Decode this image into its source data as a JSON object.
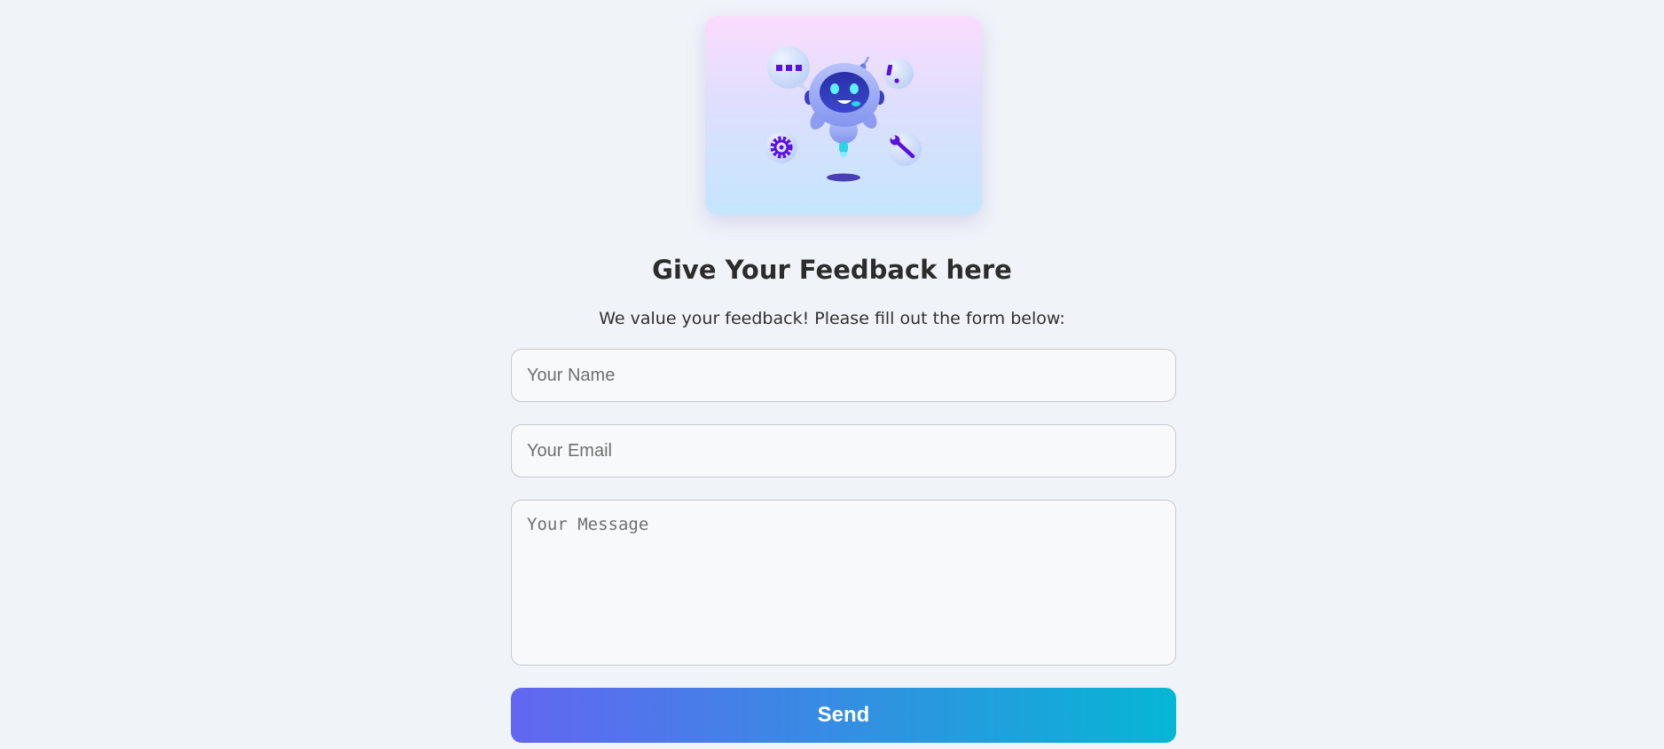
{
  "hero": {
    "image_name": "robot-illustration"
  },
  "form": {
    "title": "Give Your Feedback here",
    "subtitle": "We value your feedback! Please fill out the form below:",
    "name_placeholder": "Your Name",
    "email_placeholder": "Your Email",
    "message_placeholder": "Your Message",
    "send_label": "Send"
  },
  "icons": {
    "chat": "chat-bubble-icon",
    "alert": "exclamation-bubble-icon",
    "settings": "gear-icon",
    "tool": "wrench-icon"
  },
  "colors": {
    "page_background": "#f0f3f8",
    "button_gradient_start": "#6366f1",
    "button_gradient_end": "#06b6d4",
    "icon_accent": "#5b0fe0",
    "title_text": "#2c2c2c"
  }
}
